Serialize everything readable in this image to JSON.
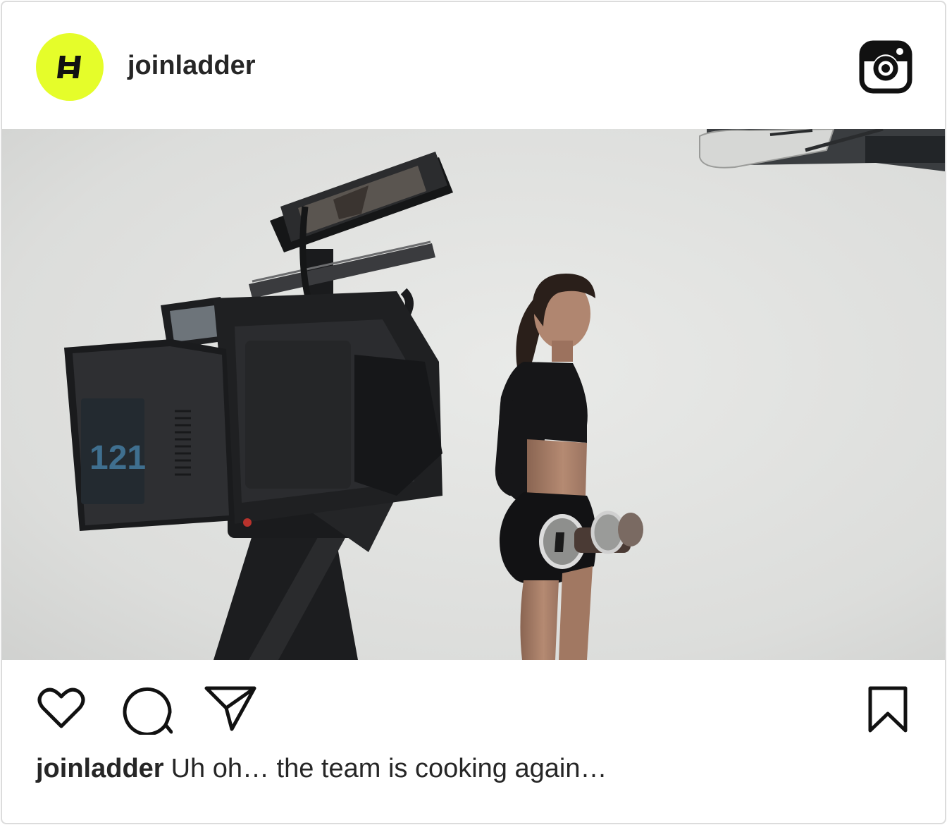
{
  "post": {
    "username": "joinladder",
    "avatar_logo": "ladder-logo",
    "brand_color": "#e5fd2a",
    "platform_icon": "instagram-icon",
    "media": {
      "camera_battery_readout": "121"
    },
    "actions": {
      "like_icon": "heart-icon",
      "comment_icon": "comment-bubble-icon",
      "share_icon": "paper-plane-icon",
      "save_icon": "bookmark-icon"
    },
    "caption": {
      "username": "joinladder",
      "text": "Uh oh… the team is cooking again…"
    }
  }
}
